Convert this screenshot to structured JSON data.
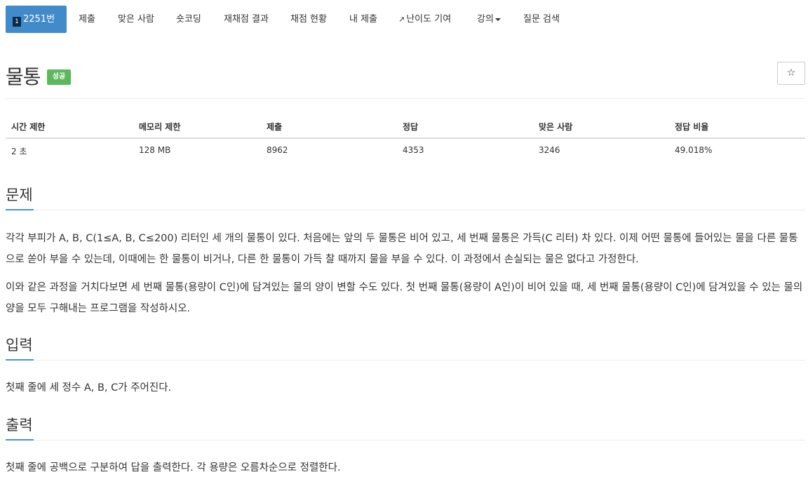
{
  "nav": {
    "active": "2251번",
    "active_icon": "1",
    "items": [
      "제출",
      "맞은 사람",
      "숏코딩",
      "재채점 결과",
      "채점 현황",
      "내 제출",
      "난이도 기여",
      "강의",
      "질문 검색"
    ]
  },
  "problem": {
    "title": "물통",
    "result": "성공",
    "star_icon": "star-icon"
  },
  "info_table": {
    "headers": [
      "시간 제한",
      "메모리 제한",
      "제출",
      "정답",
      "맞은 사람",
      "정답 비율"
    ],
    "values": [
      "2 초",
      "128 MB",
      "8962",
      "4353",
      "3246",
      "49.018%"
    ]
  },
  "sections": {
    "problem_title": "문제",
    "problem_p1": "각각 부피가 A, B, C(1≤A, B, C≤200) 리터인 세 개의 물통이 있다. 처음에는 앞의 두 물통은 비어 있고, 세 번째 물통은 가득(C 리터) 차 있다. 이제 어떤 물통에 들어있는 물을 다른 물통으로 쏟아 부을 수 있는데, 이때에는 한 물통이 비거나, 다른 한 물통이 가득 찰 때까지 물을 부을 수 있다. 이 과정에서 손실되는 물은 없다고 가정한다.",
    "problem_p2": "이와 같은 과정을 거치다보면 세 번째 물통(용량이 C인)에 담겨있는 물의 양이 변할 수도 있다. 첫 번째 물통(용량이 A인)이 비어 있을 때, 세 번째 물통(용량이 C인)에 담겨있을 수 있는 물의 양을 모두 구해내는 프로그램을 작성하시오.",
    "input_title": "입력",
    "input_text": "첫째 줄에 세 정수 A, B, C가 주어진다.",
    "output_title": "출력",
    "output_text": "첫째 줄에 공백으로 구분하여 답을 출력한다. 각 용량은 오름차순으로 정렬한다."
  },
  "colors": {
    "active_tab": "#428bca",
    "success_badge": "#5cb85c",
    "section_underline": "#4b92c9"
  }
}
